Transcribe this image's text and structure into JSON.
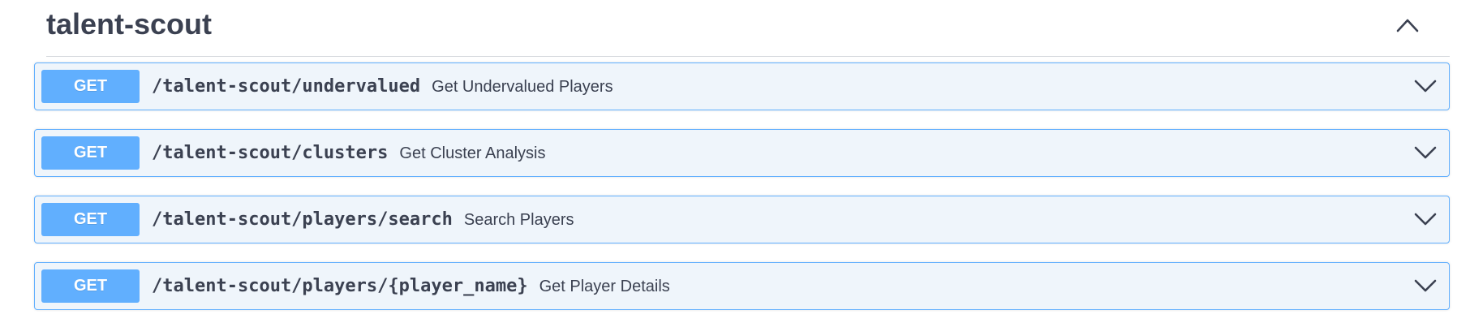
{
  "section": {
    "title": "talent-scout",
    "toggle_icon": "chevron-up-icon"
  },
  "operations": [
    {
      "method": "GET",
      "path": "/talent-scout/undervalued",
      "summary": "Get Undervalued Players",
      "expand_icon": "chevron-down-icon"
    },
    {
      "method": "GET",
      "path": "/talent-scout/clusters",
      "summary": "Get Cluster Analysis",
      "expand_icon": "chevron-down-icon"
    },
    {
      "method": "GET",
      "path": "/talent-scout/players/search",
      "summary": "Search Players",
      "expand_icon": "chevron-down-icon"
    },
    {
      "method": "GET",
      "path": "/talent-scout/players/{player_name}",
      "summary": "Get Player Details",
      "expand_icon": "chevron-down-icon"
    }
  ],
  "colors": {
    "get_accent": "#61affe",
    "get_background": "#eff5fb",
    "text": "#3b4151"
  }
}
